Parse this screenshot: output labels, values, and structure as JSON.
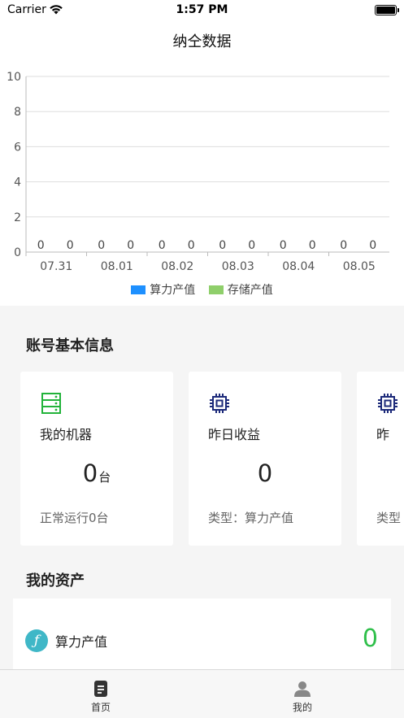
{
  "status_bar": {
    "carrier": "Carrier",
    "time": "1:57 PM"
  },
  "header": {
    "title": "纳仝数据"
  },
  "chart_data": {
    "type": "bar",
    "categories": [
      "07.31",
      "08.01",
      "08.02",
      "08.03",
      "08.04",
      "08.05"
    ],
    "series": [
      {
        "name": "算力产值",
        "values": [
          0,
          0,
          0,
          0,
          0,
          0
        ],
        "color": "#1e90ff"
      },
      {
        "name": "存储产值",
        "values": [
          0,
          0,
          0,
          0,
          0,
          0
        ],
        "color": "#8fcf6b"
      }
    ],
    "yticks": [
      "0",
      "2",
      "4",
      "6",
      "8",
      "10"
    ],
    "ylim": [
      0,
      10
    ],
    "grid": true,
    "legend_position": "bottom"
  },
  "account": {
    "title": "账号基本信息",
    "cards": [
      {
        "icon": "server-icon",
        "icon_color": "#22b33a",
        "title": "我的机器",
        "value": "0",
        "unit": "台",
        "sub": "正常运行0台"
      },
      {
        "icon": "chip-icon",
        "icon_color": "#1c2a7a",
        "title": "昨日收益",
        "value": "0",
        "unit": "",
        "sub": "类型：算力产值"
      },
      {
        "icon": "chip-icon",
        "icon_color": "#1c2a7a",
        "title": "昨",
        "value": "",
        "unit": "",
        "sub": "类型"
      }
    ]
  },
  "assets": {
    "title": "我的资产",
    "items": [
      {
        "icon": "filecoin-icon",
        "icon_glyph": "ƒ",
        "label": "算力产值",
        "value": "0"
      }
    ]
  },
  "tab_bar": {
    "tabs": [
      {
        "label": "首页",
        "icon": "home-doc-icon"
      },
      {
        "label": "我的",
        "icon": "person-icon"
      }
    ]
  }
}
